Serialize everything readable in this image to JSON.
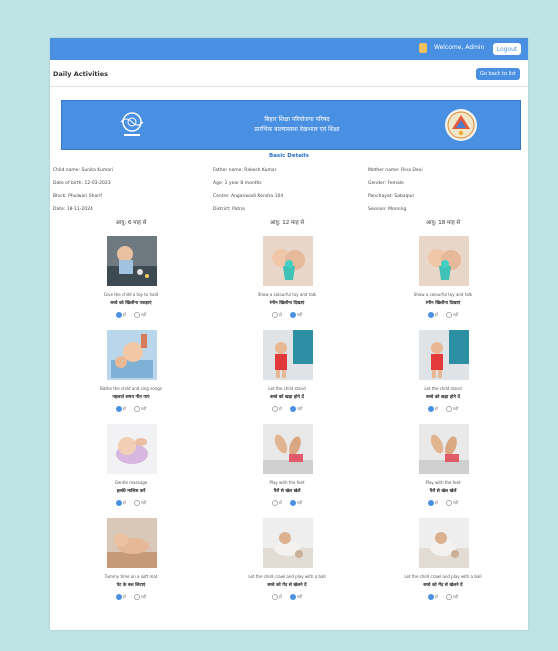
{
  "topbar": {
    "welcome_text": "Welcome, Admin",
    "logout_label": "Logout"
  },
  "page_title": "Daily Activities",
  "back_label": "Go back to list",
  "banner": {
    "line1": "बिहार शिक्षा परियोजना परिषद",
    "line2": "प्रारंभिक बाल्यावस्था देखभाल एवं शिक्षा"
  },
  "details_title": "Basic Details",
  "details": [
    "Child name: Sunita Kumari",
    "Father name: Rakesh Kumar",
    "Mother name: Rina Devi",
    "Date of birth: 12-03-2023",
    "Age: 1 year 8 months",
    "Gender: Female",
    "Block: Phulwari Sharif",
    "Centre: Anganwadi Kendra 104",
    "Panchayat: Sabalpur",
    "Date: 18-11-2024",
    "District: Patna",
    "Session: Morning"
  ],
  "column_headers": [
    "आयु: 6 माह से",
    "आयु: 12 माह से",
    "आयु: 18 माह से"
  ],
  "activities": [
    {
      "en": "Give the child a toy to hold",
      "hi": "बच्चे को खिलौना पकड़ाएं",
      "photo": "play",
      "yes": "हाँ",
      "no": "नहीं",
      "checked": "yes"
    },
    {
      "en": "Show a colourful toy and talk",
      "hi": "रंगीन खिलौना दिखाएं",
      "photo": "toy",
      "yes": "हाँ",
      "no": "नहीं",
      "checked": "no"
    },
    {
      "en": "Show a colourful toy and talk",
      "hi": "रंगीन खिलौना दिखाएं",
      "photo": "toy",
      "yes": "हाँ",
      "no": "नहीं",
      "checked": "yes"
    },
    {
      "en": "Bathe the child and sing songs",
      "hi": "नहलाते समय गीत गाएं",
      "photo": "bath",
      "yes": "हाँ",
      "no": "नहीं",
      "checked": "yes"
    },
    {
      "en": "Let the child stand",
      "hi": "बच्चे को खड़ा होने दें",
      "photo": "stand",
      "yes": "हाँ",
      "no": "नहीं",
      "checked": "no"
    },
    {
      "en": "Let the child stand",
      "hi": "बच्चे को खड़ा होने दें",
      "photo": "stand",
      "yes": "हाँ",
      "no": "नहीं",
      "checked": "yes"
    },
    {
      "en": "Gentle massage",
      "hi": "हल्की मालिश करें",
      "photo": "baby",
      "yes": "हाँ",
      "no": "नहीं",
      "checked": "yes"
    },
    {
      "en": "Play with the feet",
      "hi": "पैरों से खेल खेलें",
      "photo": "feet",
      "yes": "हाँ",
      "no": "नहीं",
      "checked": "no"
    },
    {
      "en": "Play with the feet",
      "hi": "पैरों से खेल खेलें",
      "photo": "feet",
      "yes": "हाँ",
      "no": "नहीं",
      "checked": "yes"
    },
    {
      "en": "Tummy time on a soft mat",
      "hi": "पेट के बल लिटाएं",
      "photo": "tummy",
      "yes": "हाँ",
      "no": "नहीं",
      "checked": "yes"
    },
    {
      "en": "Let the child crawl and play with a ball",
      "hi": "बच्चे को गेंद से खेलने दें",
      "photo": "crawl",
      "yes": "हाँ",
      "no": "नहीं",
      "checked": "no"
    },
    {
      "en": "Let the child crawl and play with a ball",
      "hi": "बच्चे को गेंद से खेलने दें",
      "photo": "crawl",
      "yes": "हाँ",
      "no": "नहीं",
      "checked": "yes"
    }
  ],
  "colors": {
    "page_background": "#bfe4e6",
    "accent": "#4a90e2",
    "banner": "#4a90e2"
  }
}
